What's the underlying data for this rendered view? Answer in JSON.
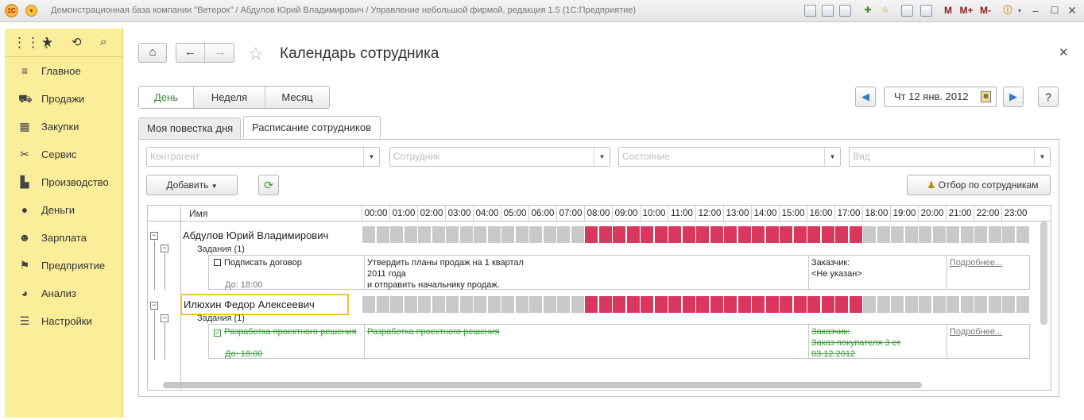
{
  "window": {
    "title": "Демонстрационная база компании \"Ветерок\" / Абдулов Юрий Владимирович / Управление небольшой фирмой, редакция 1.5  (1С:Предприятие)",
    "logo_text": "1С",
    "memory_buttons": [
      "M",
      "M+",
      "M-"
    ]
  },
  "sidebar": {
    "items": [
      {
        "label": "Главное",
        "icon": "menu-icon"
      },
      {
        "label": "Продажи",
        "icon": "basket-icon"
      },
      {
        "label": "Закупки",
        "icon": "grid-icon"
      },
      {
        "label": "Сервис",
        "icon": "tools-icon"
      },
      {
        "label": "Производство",
        "icon": "factory-icon"
      },
      {
        "label": "Деньги",
        "icon": "ruble-icon"
      },
      {
        "label": "Зарплата",
        "icon": "people-icon"
      },
      {
        "label": "Предприятие",
        "icon": "flag-icon"
      },
      {
        "label": "Анализ",
        "icon": "chart-icon"
      },
      {
        "label": "Настройки",
        "icon": "settings-icon"
      }
    ]
  },
  "header": {
    "title": "Календарь сотрудника",
    "help_label": "?"
  },
  "period": {
    "buttons": [
      "День",
      "Неделя",
      "Месяц"
    ],
    "active": "День",
    "date": "Чт 12 янв. 2012"
  },
  "tabs": [
    "Моя повестка дня",
    "Расписание сотрудников"
  ],
  "filters": {
    "counterparty_placeholder": "Контрагент",
    "employee_placeholder": "Сотрудник",
    "state_placeholder": "Состояние",
    "kind_placeholder": "Вид"
  },
  "toolbar": {
    "add_label": "Добавить",
    "filter_by_employees_label": "Отбор по сотрудникам"
  },
  "schedule": {
    "name_header": "Имя",
    "hours": [
      "00:00",
      "01:00",
      "02:00",
      "03:00",
      "04:00",
      "05:00",
      "06:00",
      "07:00",
      "08:00",
      "09:00",
      "10:00",
      "11:00",
      "12:00",
      "13:00",
      "14:00",
      "15:00",
      "16:00",
      "17:00",
      "18:00",
      "19:00",
      "20:00",
      "21:00",
      "22:00",
      "23:00"
    ],
    "busy_from_hour": 8,
    "busy_to_hour": 18,
    "busy_color": "#d9375e",
    "free_color": "#c9c9c9",
    "employees": [
      {
        "name": "Абдулов Юрий Владимирович",
        "tasks_label": "Задания (1)",
        "task": {
          "title": "Подписать договор",
          "due": "До: 18:00",
          "description_lines": [
            "Утвердить планы продаж на 1 квартал",
            "2011 года",
            "и отправить начальнику продаж."
          ],
          "customer_label": "Заказчик:",
          "customer_lines": [
            "<Не указан>"
          ],
          "more_label": "Подробнее...",
          "done": false
        }
      },
      {
        "name": "Илюхин Федор Алексеевич",
        "tasks_label": "Задания (1)",
        "task": {
          "title": "Разработка проектного решения",
          "due": "До: 18:00",
          "description_lines": [
            "Разработка проектного решения"
          ],
          "customer_label": "Заказчик:",
          "customer_lines": [
            "Заказ покупателя 3 от",
            "03.12.2012"
          ],
          "more_label": "Подробнее...",
          "done": true
        }
      }
    ]
  }
}
